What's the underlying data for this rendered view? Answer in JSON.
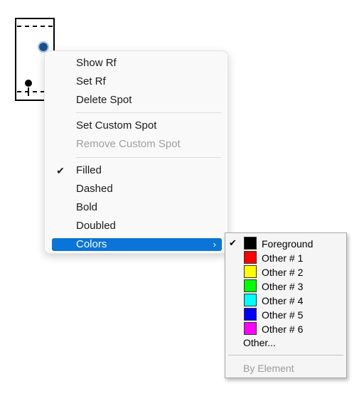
{
  "context_menu": {
    "items": [
      {
        "label": "Show Rf"
      },
      {
        "label": "Set Rf"
      },
      {
        "label": "Delete Spot"
      },
      {
        "label": "Set Custom Spot"
      },
      {
        "label": "Remove Custom Spot",
        "disabled": true
      },
      {
        "label": "Filled",
        "checked": true,
        "check": "✔"
      },
      {
        "label": "Dashed"
      },
      {
        "label": "Bold"
      },
      {
        "label": "Doubled"
      },
      {
        "label": "Colors",
        "highlighted": true,
        "arrow": "›"
      }
    ]
  },
  "colors_submenu": {
    "check": "✔",
    "items": [
      {
        "label": "Foreground",
        "color": "#000000",
        "checked": true
      },
      {
        "label": "Other # 1",
        "color": "#ff0000"
      },
      {
        "label": "Other # 2",
        "color": "#ffff00"
      },
      {
        "label": "Other # 3",
        "color": "#00ff00"
      },
      {
        "label": "Other # 4",
        "color": "#00ffff"
      },
      {
        "label": "Other # 5",
        "color": "#0000ff"
      },
      {
        "label": "Other # 6",
        "color": "#ff00ff"
      }
    ],
    "other_label": "Other...",
    "by_element_label": "By Element"
  },
  "colors": {
    "selected_spot": "#1b4f86",
    "menu_highlight": "#0a74d8"
  }
}
